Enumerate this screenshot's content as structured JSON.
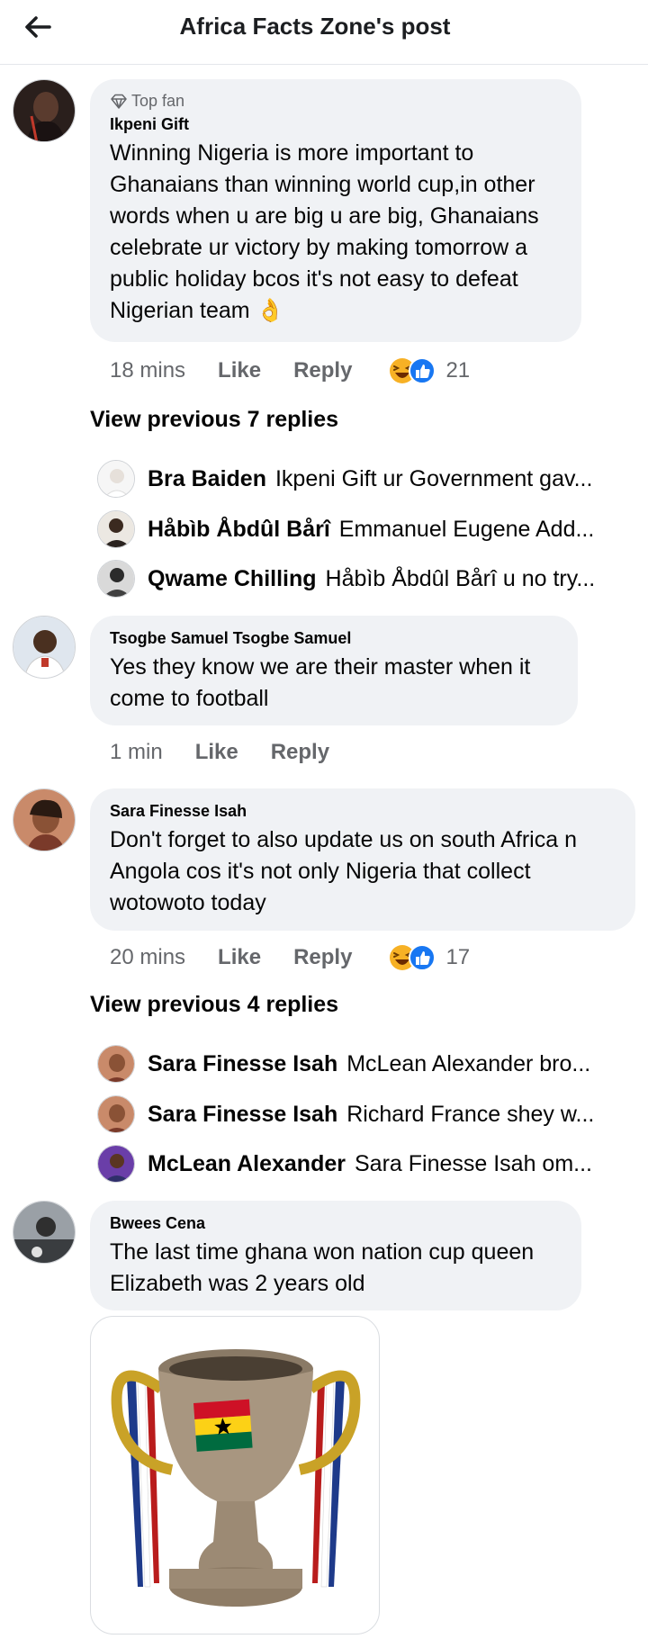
{
  "header": {
    "title": "Africa Facts Zone's post",
    "back_icon": "arrow-left-icon"
  },
  "comments": [
    {
      "badge": "Top fan",
      "author": "Ikpeni Gift",
      "text": "Winning Nigeria is more important to Ghanaians than winning world cup,in other words when u are big u are big, Ghanaians celebrate ur victory by making tomorrow a public holiday bcos it's not easy to defeat Nigerian team 👌",
      "time": "18 mins",
      "like": "Like",
      "reply": "Reply",
      "reaction_count": "21"
    },
    {
      "author": "Tsogbe Samuel Tsogbe Samuel",
      "text": "Yes they know we are their master when it come to football",
      "time": "1 min",
      "like": "Like",
      "reply": "Reply"
    },
    {
      "author": "Sara Finesse Isah",
      "text": "Don't forget to also update us on south Africa n Angola cos it's not only Nigeria that collect wotowoto today",
      "time": "20 mins",
      "like": "Like",
      "reply": "Reply",
      "reaction_count": "17"
    },
    {
      "author": "Bwees Cena",
      "text": "The last time ghana won nation cup queen Elizabeth was 2 years old"
    }
  ],
  "threads": [
    {
      "view_previous": "View previous 7 replies",
      "replies": [
        {
          "name": "Bra Baiden",
          "text": "Ikpeni Gift ur Government gav..."
        },
        {
          "name": "Håbìb Åbdûl Bårî",
          "text": "Emmanuel Eugene Add..."
        },
        {
          "name": "Qwame Chilling",
          "text": "Håbìb Åbdûl Bårî u no try..."
        }
      ]
    },
    {
      "view_previous": "View previous 4 replies",
      "replies": [
        {
          "name": "Sara Finesse Isah",
          "text": "McLean Alexander bro..."
        },
        {
          "name": "Sara Finesse Isah",
          "text": "Richard France shey w..."
        },
        {
          "name": "McLean Alexander",
          "text": "Sara Finesse Isah om..."
        }
      ]
    }
  ],
  "attachment": {
    "icon": "ghana-trophy-sticker"
  },
  "colors": {
    "bubble": "#f0f2f5",
    "meta_text": "#65676b",
    "like_blue": "#1877f2",
    "haha_yellow": "#f7b125"
  }
}
